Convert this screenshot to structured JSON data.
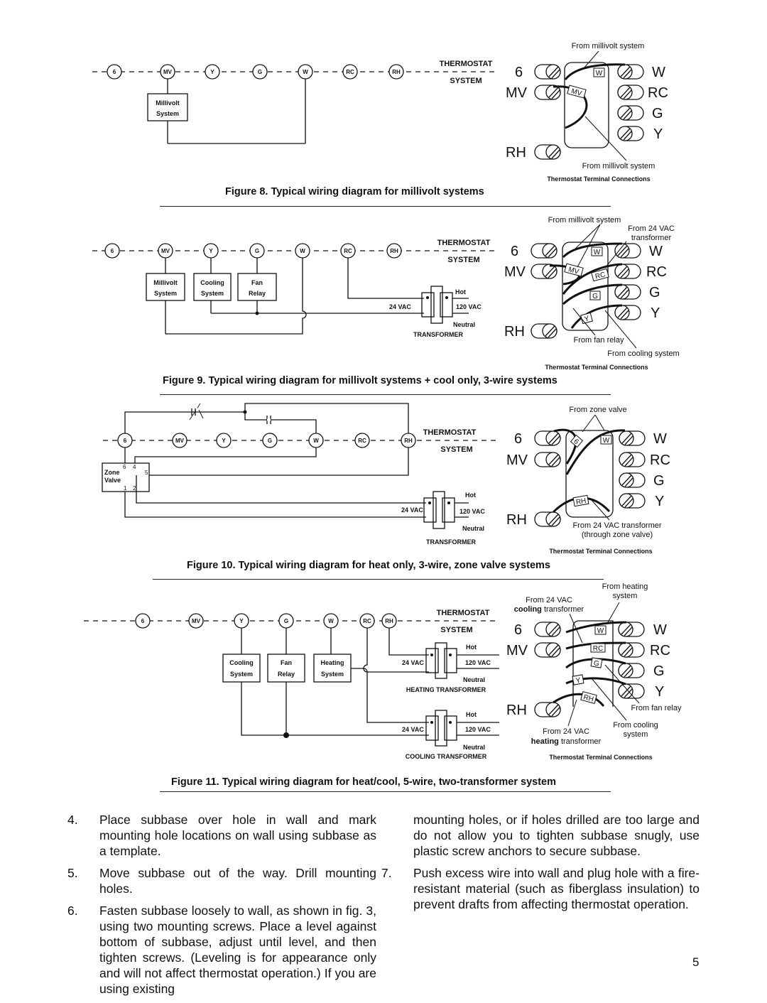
{
  "terminals": [
    "6",
    "MV",
    "Y",
    "G",
    "W",
    "RC",
    "RH"
  ],
  "thermostat_label": "THERMOSTAT",
  "system_label": "SYSTEM",
  "terminal_panel": {
    "left_labels": [
      "6",
      "MV",
      "RH"
    ],
    "right_labels": [
      "W",
      "RC",
      "G",
      "Y"
    ],
    "title": "Thermostat Terminal Connections"
  },
  "transformer": {
    "hot": "Hot",
    "neutral": "Neutral",
    "low_v": "24 VAC",
    "high_v": "120 VAC"
  },
  "figures": [
    {
      "caption": "Figure 8. Typical wiring diagram for millivolt systems",
      "boxes": [
        {
          "line1": "Millivolt",
          "line2": "System"
        }
      ],
      "callouts": [
        "From millivolt system",
        "From millivolt system"
      ],
      "wire_tags": [
        "W",
        "MV"
      ]
    },
    {
      "caption": "Figure 9. Typical wiring diagram for millivolt systems + cool only, 3-wire systems",
      "boxes": [
        {
          "line1": "Millivolt",
          "line2": "System"
        },
        {
          "line1": "Cooling",
          "line2": "System"
        },
        {
          "line1": "Fan",
          "line2": "Relay"
        }
      ],
      "transformer_label": "TRANSFORMER",
      "callouts": [
        "From millivolt system",
        "From 24 VAC",
        "transformer",
        "From fan relay",
        "From cooling system"
      ],
      "wire_tags": [
        "W",
        "MV",
        "RC",
        "G",
        "Y"
      ]
    },
    {
      "caption": "Figure 10. Typical wiring diagram for heat only, 3-wire, zone valve systems",
      "zone_valve": {
        "line1": "Zone",
        "line2": "Valve",
        "pins": [
          "6",
          "4",
          "5",
          "1",
          "2"
        ]
      },
      "transformer_label": "TRANSFORMER",
      "callouts": [
        "From zone valve",
        "From 24 VAC transformer",
        "(through zone valve)"
      ],
      "wire_tags": [
        "6",
        "W",
        "RH"
      ]
    },
    {
      "caption": "Figure 11. Typical wiring diagram for heat/cool, 5-wire, two-transformer system",
      "boxes": [
        {
          "line1": "Cooling",
          "line2": "System"
        },
        {
          "line1": "Fan",
          "line2": "Relay"
        },
        {
          "line1": "Heating",
          "line2": "System"
        }
      ],
      "heating_transformer_label": "HEATING TRANSFORMER",
      "cooling_transformer_label": "COOLING TRANSFORMER",
      "callouts": {
        "heating_system_1": "From heating",
        "heating_system_2": "system",
        "cool_tx_1": "From 24 VAC",
        "cool_tx_bold": "cooling",
        "cool_tx_2": " transformer",
        "fan": "From fan relay",
        "cooling_1": "From cooling",
        "cooling_2": "system",
        "heat_tx_1": "From 24 VAC",
        "heat_tx_bold": "heating",
        "heat_tx_2": " transformer"
      },
      "wire_tags": [
        "W",
        "RC",
        "G",
        "Y",
        "RH"
      ]
    }
  ],
  "steps_left": [
    {
      "num": "4.",
      "text": "Place subbase over hole in wall and mark mounting hole locations on wall using subbase as a template."
    },
    {
      "num": "5.",
      "text": "Move subbase out of the way. Drill mounting holes."
    },
    {
      "num": "6.",
      "text": "Fasten subbase loosely to wall, as shown in fig. 3, using two mounting screws. Place a level against bottom of subbase, adjust until level, and then tighten screws. (Leveling is for appearance only and will not affect thermostat operation.) If you are using existing"
    }
  ],
  "continuation_right": "mounting holes, or if holes drilled are too large and do not allow you to tighten subbase snugly, use plastic screw  anchors to secure subbase.",
  "steps_right": [
    {
      "num": "7.",
      "text": "Push excess wire into wall and plug hole with a fire-resistant material (such as fiberglass insulation) to prevent drafts from affecting thermostat operation."
    }
  ],
  "page_number": "5"
}
